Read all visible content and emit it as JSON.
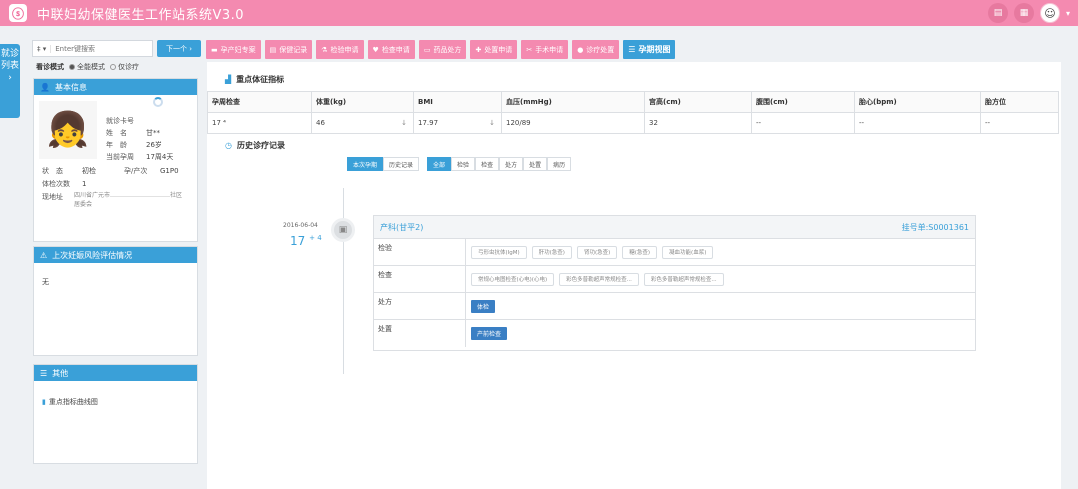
{
  "app": {
    "title": "中联妇幼保健医生工作站系统V3.0",
    "logo_icon": "logo-icon"
  },
  "side_tab": {
    "label": "就诊列表 ›"
  },
  "search": {
    "prefix": "‡ ▾",
    "placeholder": "Enter键搜索",
    "next_label": "下一个 ›"
  },
  "mode": {
    "label": "看诊模式",
    "option_all": "全能模式",
    "option_treat": "仅诊疗"
  },
  "basic_info": {
    "title": "基本信息",
    "name_key": "姓　名",
    "name_val": "甘**",
    "card_key": "就诊卡号",
    "card_val": "",
    "age_key": "年　龄",
    "age_val": "26岁",
    "gest_key": "当前孕周",
    "gest_val": "17周4天",
    "status_key": "状　态",
    "status_val": "初检",
    "gp_key": "孕/产次",
    "gp_val": "G1P0",
    "visits_key": "体检次数",
    "visits_val": "1",
    "addr_key": "现地址",
    "addr_val": "四川省广元市…………………………社区居委会"
  },
  "risk": {
    "title": "上次妊娠风险评估情况",
    "value": "无"
  },
  "other": {
    "title": "其他",
    "chart_link": "重点指标曲线图"
  },
  "nav": [
    {
      "label": "孕产妇专案",
      "icon": "folder-icon"
    },
    {
      "label": "保健记录",
      "icon": "record-icon"
    },
    {
      "label": "检验申请",
      "icon": "flask-icon"
    },
    {
      "label": "检查申请",
      "icon": "heart-icon"
    },
    {
      "label": "药品处方",
      "icon": "pill-icon"
    },
    {
      "label": "处置申请",
      "icon": "bandage-icon"
    },
    {
      "label": "手术申请",
      "icon": "scissors-icon"
    },
    {
      "label": "诊疗处置",
      "icon": "user-icon"
    },
    {
      "label": "孕期视图",
      "icon": "list-icon",
      "active": true
    }
  ],
  "vitals": {
    "title": "重点体征指标",
    "headers": [
      "孕周检查",
      "体重(kg)",
      "BMI",
      "血压(mmHg)",
      "宫高(cm)",
      "腹围(cm)",
      "胎心(bpm)",
      "胎方位"
    ],
    "values": [
      "17 ⁴",
      "46",
      "17.97",
      "120/89",
      "32",
      "--",
      "--",
      "--"
    ]
  },
  "history": {
    "title": "历史诊疗记录",
    "tabs_view": [
      "本次孕期",
      "历史记录"
    ],
    "tabs_filter": [
      "全部",
      "检验",
      "检查",
      "处方",
      "处置",
      "病历"
    ],
    "date": "2016-06-04",
    "week": "17",
    "week_day": "+ 4",
    "dept": "产科(甘平2)",
    "reg_no": "挂号单:S0001361",
    "rows": [
      {
        "label": "检验",
        "items": [
          "弓形虫抗体(IgM)",
          "肝功(急查)",
          "肾功(急查)",
          "糖(急查)",
          "凝血功能(血浆)"
        ]
      },
      {
        "label": "检查",
        "items": [
          "常规心电图检查(心电)(心电)",
          "彩色多普勒超声常规检查...",
          "彩色多普勒超声常规检查..."
        ]
      },
      {
        "label": "处方",
        "buttons": [
          "体检"
        ]
      },
      {
        "label": "处置",
        "buttons": [
          "产前检查"
        ]
      }
    ]
  },
  "colors": {
    "brand_pink": "#f48ab0",
    "accent_blue": "#3aa0d8"
  }
}
